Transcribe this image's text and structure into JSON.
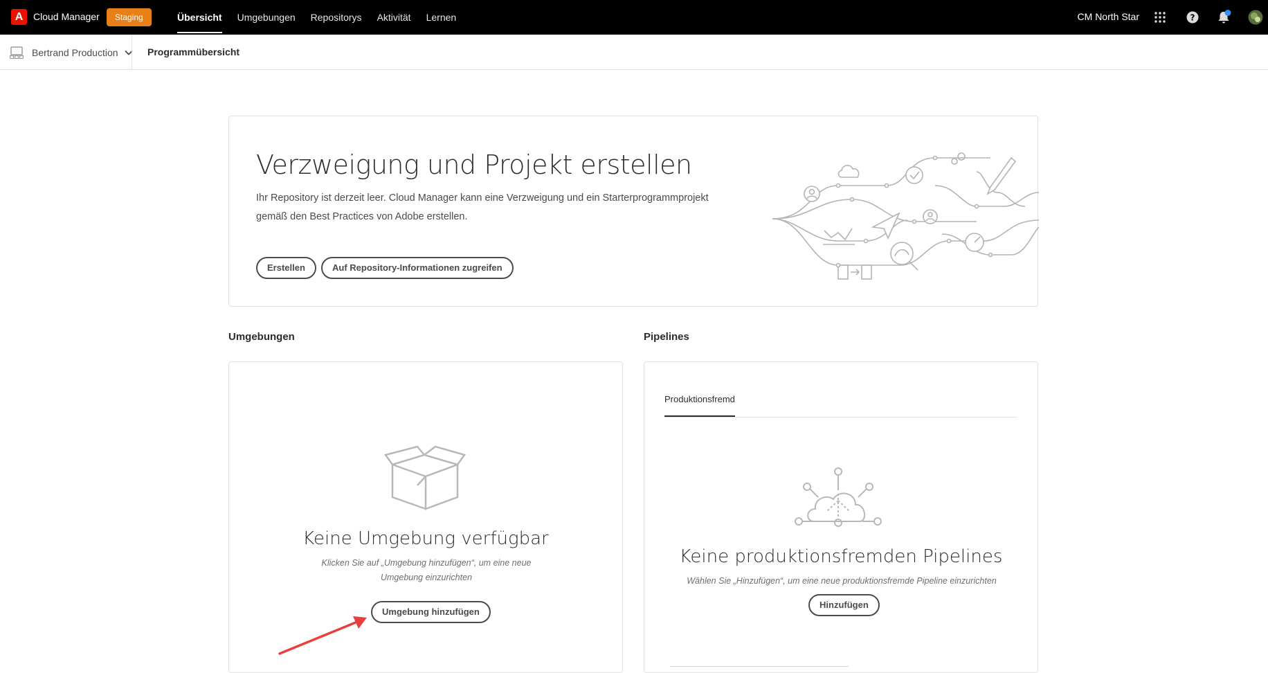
{
  "app": {
    "logo_letter": "A",
    "title": "Cloud Manager",
    "env_badge": "Staging",
    "org_name": "CM North Star"
  },
  "nav": {
    "items": [
      {
        "label": "Übersicht",
        "active": true
      },
      {
        "label": "Umgebungen",
        "active": false
      },
      {
        "label": "Repositorys",
        "active": false
      },
      {
        "label": "Aktivität",
        "active": false
      },
      {
        "label": "Lernen",
        "active": false
      }
    ]
  },
  "topbar_icons": [
    "apps-grid-icon",
    "help-icon",
    "notifications-bell-icon",
    "user-avatar"
  ],
  "subheader": {
    "program_name": "Bertrand Production",
    "breadcrumb": "Programmübersicht"
  },
  "hero": {
    "title": "Verzweigung und Projekt erstellen",
    "description": "Ihr Repository ist derzeit leer. Cloud Manager kann eine Verzweigung und ein Starterprogrammprojekt gemäß den Best Practices von Adobe erstellen.",
    "create_button": "Erstellen",
    "repo_info_button": "Auf Repository-Informationen zugreifen"
  },
  "environments": {
    "section_title": "Umgebungen",
    "empty_title": "Keine Umgebung verfügbar",
    "empty_desc": "Klicken Sie auf „Umgebung hinzufügen“, um eine neue Umgebung einzurichten",
    "add_button": "Umgebung hinzufügen"
  },
  "pipelines": {
    "section_title": "Pipelines",
    "tab_label": "Produktionsfremd",
    "empty_title": "Keine produktionsfremden Pipelines",
    "empty_desc": "Wählen Sie „Hinzufügen“, um eine neue produktionsfremde Pipeline einzurichten",
    "add_button": "Hinzufügen"
  },
  "colors": {
    "topbar_bg": "#000000",
    "brand_red": "#eb1000",
    "badge_orange": "#e8801a",
    "notification_dot": "#378ef0",
    "annotation_arrow": "#e8403c"
  }
}
